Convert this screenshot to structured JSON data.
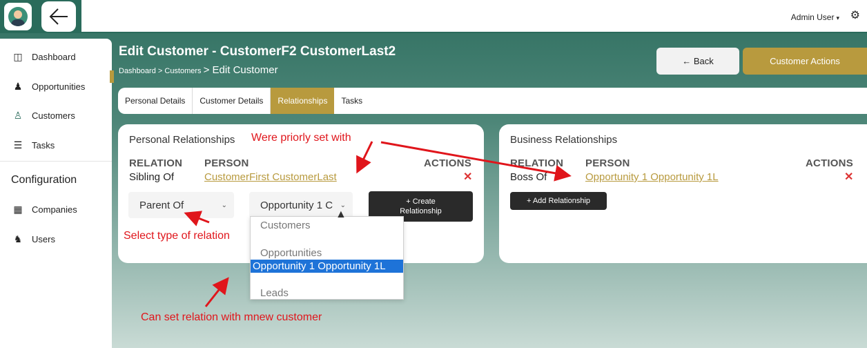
{
  "topbar": {
    "user_label": "Admin User",
    "caret": "▾",
    "gear_glyph": "⚙",
    "back_glyph": "←"
  },
  "sidebar": {
    "items": [
      {
        "label": "Dashboard",
        "icon": "dashboard-icon",
        "glyph": "◫"
      },
      {
        "label": "Opportunities",
        "icon": "people-icon",
        "glyph": "👥"
      },
      {
        "label": "Customers",
        "icon": "customer-icon",
        "glyph": "👤"
      },
      {
        "label": "Tasks",
        "icon": "tasks-icon",
        "glyph": "☰"
      }
    ],
    "config_heading": "Configuration",
    "config_items": [
      {
        "label": "Companies",
        "icon": "building-icon",
        "glyph": "▦"
      },
      {
        "label": "Users",
        "icon": "users-icon",
        "glyph": "🕵"
      }
    ]
  },
  "header": {
    "title": "Edit Customer - CustomerF2 CustomerLast2",
    "crumb_dashboard": "Dashboard",
    "crumb_customers": "> Customers",
    "crumb_edit": "> Edit Customer",
    "back_label": "← Back",
    "actions_label": "Customer Actions"
  },
  "tabs": [
    "Personal Details",
    "Customer Details",
    "Relationships",
    "Tasks"
  ],
  "personal": {
    "title": "Personal Relationships",
    "col_relation": "RELATION",
    "col_person": "PERSON",
    "col_actions": "ACTIONS",
    "row_relation": "Sibling Of",
    "row_person": "CustomerFirst CustomerLast",
    "relation_select": "Parent Of",
    "person_select": "Opportunity 1 C",
    "create_plus": "+ Create",
    "create_label": "Relationship"
  },
  "business": {
    "title": "Business Relationships",
    "col_relation": "RELATION",
    "col_person": "PERSON",
    "col_actions": "ACTIONS",
    "row_relation": "Boss Of",
    "row_person": "Opportunity 1 Opportunity 1L",
    "add_label": "+ Add Relationship"
  },
  "dropdown": {
    "group1": "Customers",
    "group2": "Opportunities",
    "selected": "Opportunity 1 Opportunity 1L",
    "group3": "Leads"
  },
  "annotations": {
    "priorly": "Were priorly set with",
    "select_type": "Select type of relation",
    "new_customer": "Can set relation with mnew customer"
  },
  "colors": {
    "accent": "#b89a3e",
    "teal": "#2a6b5b",
    "annotation": "#e0151b",
    "selection": "#1e73d8"
  }
}
